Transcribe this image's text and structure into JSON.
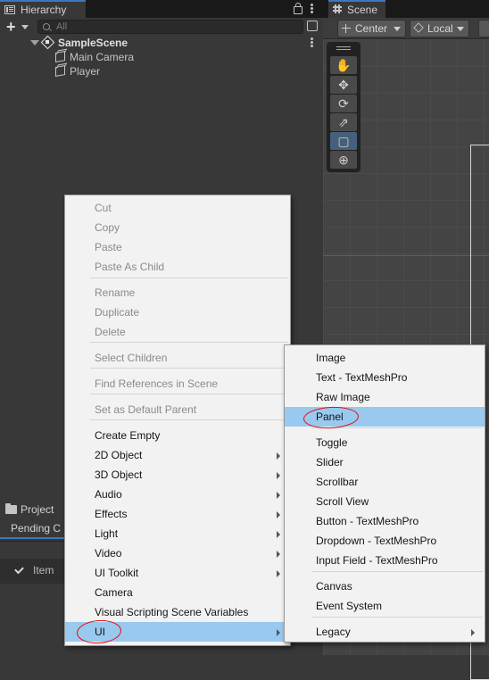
{
  "hierarchy": {
    "tab_label": "Hierarchy",
    "add_label": "+",
    "search_placeholder": "All",
    "scene_name": "SampleScene",
    "objects": [
      "Main Camera",
      "Player"
    ]
  },
  "scene": {
    "tab_label": "Scene",
    "pivot_mode": "Center",
    "pivot_rotation": "Local",
    "tools": [
      "view-tool",
      "move-tool",
      "rotate-tool",
      "scale-tool",
      "rect-tool",
      "transform-tool"
    ],
    "active_tool": "rect-tool"
  },
  "project": {
    "tab_label": "Project",
    "subtab_label": "Pending C",
    "item_label": "Item"
  },
  "context_menu": {
    "items": [
      {
        "label": "Cut",
        "disabled": true
      },
      {
        "label": "Copy",
        "disabled": true
      },
      {
        "label": "Paste",
        "disabled": true
      },
      {
        "label": "Paste As Child",
        "disabled": true
      },
      {
        "label": "Rename",
        "disabled": true
      },
      {
        "label": "Duplicate",
        "disabled": true
      },
      {
        "label": "Delete",
        "disabled": true
      },
      {
        "label": "Select Children",
        "disabled": true
      },
      {
        "label": "Find References in Scene",
        "disabled": true
      },
      {
        "label": "Set as Default Parent",
        "disabled": true
      },
      {
        "label": "Create Empty",
        "disabled": false
      },
      {
        "label": "2D Object",
        "disabled": false,
        "submenu": true
      },
      {
        "label": "3D Object",
        "disabled": false,
        "submenu": true
      },
      {
        "label": "Audio",
        "disabled": false,
        "submenu": true
      },
      {
        "label": "Effects",
        "disabled": false,
        "submenu": true
      },
      {
        "label": "Light",
        "disabled": false,
        "submenu": true
      },
      {
        "label": "Video",
        "disabled": false,
        "submenu": true
      },
      {
        "label": "UI Toolkit",
        "disabled": false,
        "submenu": true
      },
      {
        "label": "Camera",
        "disabled": false
      },
      {
        "label": "Visual Scripting Scene Variables",
        "disabled": false
      },
      {
        "label": "UI",
        "disabled": false,
        "submenu": true,
        "highlighted": true
      }
    ]
  },
  "ui_submenu": {
    "items": [
      {
        "label": "Image"
      },
      {
        "label": "Text - TextMeshPro"
      },
      {
        "label": "Raw Image"
      },
      {
        "label": "Panel",
        "highlighted": true
      },
      {
        "label": "Toggle"
      },
      {
        "label": "Slider"
      },
      {
        "label": "Scrollbar"
      },
      {
        "label": "Scroll View"
      },
      {
        "label": "Button - TextMeshPro"
      },
      {
        "label": "Dropdown - TextMeshPro"
      },
      {
        "label": "Input Field - TextMeshPro"
      },
      {
        "label": "Canvas"
      },
      {
        "label": "Event System"
      },
      {
        "label": "Legacy",
        "submenu": true
      }
    ]
  },
  "colors": {
    "highlight": "#99c9ef",
    "annotation": "#e01010",
    "accent": "#3a79bb"
  }
}
